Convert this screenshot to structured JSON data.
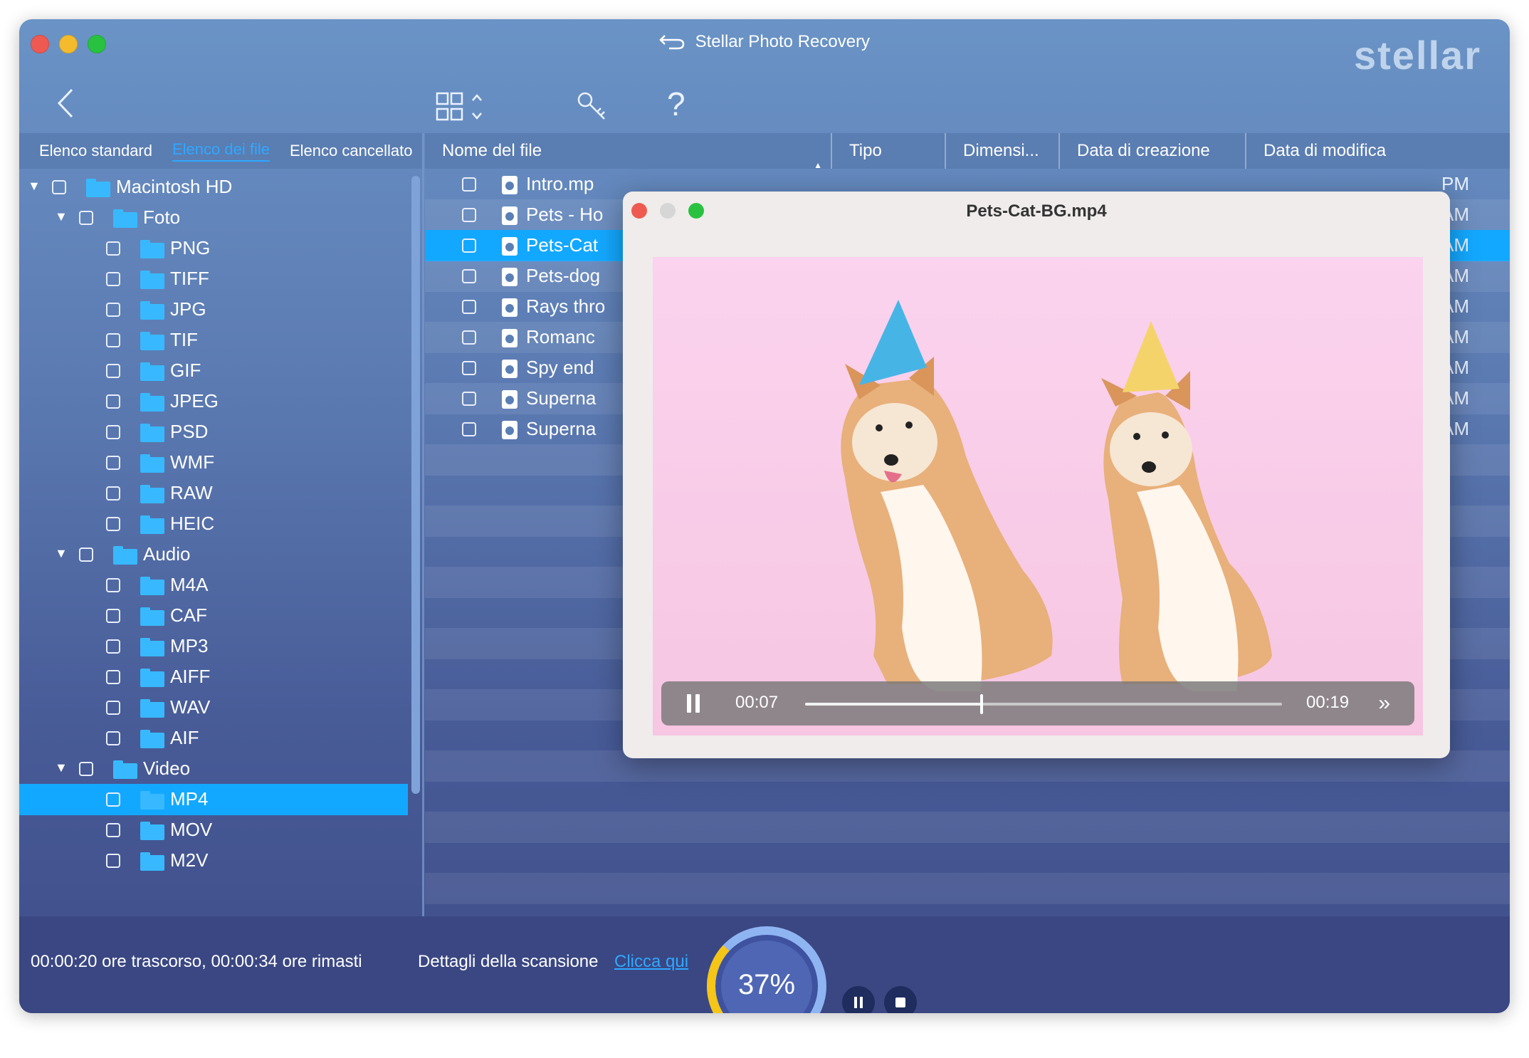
{
  "window": {
    "title": "Stellar Photo Recovery",
    "brand": "stellar"
  },
  "tabs": [
    "Elenco standard",
    "Elenco dei file",
    "Elenco cancellato"
  ],
  "columns": [
    "Nome del file",
    "Tipo",
    "Dimensi...",
    "Data di creazione",
    "Data di modifica"
  ],
  "tree": [
    {
      "label": "Macintosh HD",
      "level": 0,
      "expanded": true
    },
    {
      "label": "Foto",
      "level": 1,
      "expanded": true
    },
    {
      "label": "PNG",
      "level": 2
    },
    {
      "label": "TIFF",
      "level": 2
    },
    {
      "label": "JPG",
      "level": 2
    },
    {
      "label": "TIF",
      "level": 2
    },
    {
      "label": "GIF",
      "level": 2
    },
    {
      "label": "JPEG",
      "level": 2
    },
    {
      "label": "PSD",
      "level": 2
    },
    {
      "label": "WMF",
      "level": 2
    },
    {
      "label": "RAW",
      "level": 2
    },
    {
      "label": "HEIC",
      "level": 2
    },
    {
      "label": "Audio",
      "level": 1,
      "expanded": true
    },
    {
      "label": "M4A",
      "level": 2
    },
    {
      "label": "CAF",
      "level": 2
    },
    {
      "label": "MP3",
      "level": 2
    },
    {
      "label": "AIFF",
      "level": 2
    },
    {
      "label": "WAV",
      "level": 2
    },
    {
      "label": "AIF",
      "level": 2
    },
    {
      "label": "Video",
      "level": 1,
      "expanded": true
    },
    {
      "label": "MP4",
      "level": 2,
      "selected": true
    },
    {
      "label": "MOV",
      "level": 2
    },
    {
      "label": "M2V",
      "level": 2
    }
  ],
  "files": [
    {
      "name": "Intro.mp",
      "ampm": "PM"
    },
    {
      "name": "Pets - Ho",
      "ampm": "AM"
    },
    {
      "name": "Pets-Cat",
      "ampm": "AM",
      "selected": true
    },
    {
      "name": "Pets-dog",
      "ampm": "AM"
    },
    {
      "name": "Rays thro",
      "ampm": "AM"
    },
    {
      "name": "Romanc",
      "ampm": "AM"
    },
    {
      "name": "Spy end",
      "ampm": "AM"
    },
    {
      "name": "Superna",
      "ampm": "AM"
    },
    {
      "name": "Superna",
      "ampm": "AM"
    }
  ],
  "preview": {
    "title": "Pets-Cat-BG.mp4",
    "current_time": "00:07",
    "total_time": "00:19",
    "progress": 0.37
  },
  "bottom": {
    "elapsed": "00:00:20 ore trascorso, 00:00:34 ore rimasti",
    "details_label": "Dettagli della scansione",
    "details_link": "Clicca qui",
    "scan_percent": "37%",
    "scan_fraction": 0.37
  },
  "colors": {
    "accent": "#13a8ff",
    "progress_ring": "#f5c518"
  }
}
